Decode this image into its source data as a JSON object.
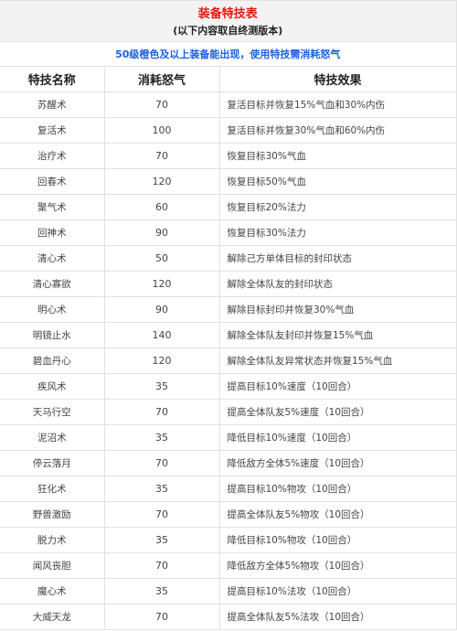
{
  "title": "装备特技表",
  "subtitle": "(以下内容取自终测版本)",
  "note": "50级橙色及以上装备能出现，使用特技需消耗怒气",
  "colors": {
    "title": "#e8160f",
    "note": "#1d5fe0",
    "header_bg": "#f3f3f3",
    "border": "#e2e2e2"
  },
  "columns": [
    "特技名称",
    "消耗怒气",
    "特技效果"
  ],
  "rows": [
    {
      "name": "苏醒术",
      "cost": "70",
      "effect": "复活目标并恢复15%气血和30%内伤"
    },
    {
      "name": "复活术",
      "cost": "100",
      "effect": "复活目标并恢复30%气血和60%内伤"
    },
    {
      "name": "治疗术",
      "cost": "70",
      "effect": "恢复目标30%气血"
    },
    {
      "name": "回春术",
      "cost": "120",
      "effect": "恢复目标50%气血"
    },
    {
      "name": "聚气术",
      "cost": "60",
      "effect": "恢复目标20%法力"
    },
    {
      "name": "回神术",
      "cost": "90",
      "effect": "恢复目标30%法力"
    },
    {
      "name": "清心术",
      "cost": "50",
      "effect": "解除己方单体目标的封印状态"
    },
    {
      "name": "清心寡欲",
      "cost": "120",
      "effect": "解除全体队友的封印状态"
    },
    {
      "name": "明心术",
      "cost": "90",
      "effect": "解除目标封印并恢复30%气血"
    },
    {
      "name": "明镜止水",
      "cost": "140",
      "effect": "解除全体队友封印并恢复15%气血"
    },
    {
      "name": "碧血丹心",
      "cost": "120",
      "effect": "解除全体队友异常状态并恢复15%气血"
    },
    {
      "name": "疾风术",
      "cost": "35",
      "effect": "提高目标10%速度（10回合）"
    },
    {
      "name": "天马行空",
      "cost": "70",
      "effect": "提高全体队友5%速度（10回合）"
    },
    {
      "name": "泥沼术",
      "cost": "35",
      "effect": "降低目标10%速度（10回合）"
    },
    {
      "name": "停云落月",
      "cost": "70",
      "effect": "降低敌方全体5%速度（10回合）"
    },
    {
      "name": "狂化术",
      "cost": "35",
      "effect": "提高目标10%物攻（10回合）"
    },
    {
      "name": "野兽激励",
      "cost": "70",
      "effect": "提高全体队友5%物攻（10回合）"
    },
    {
      "name": "脱力术",
      "cost": "35",
      "effect": "降低目标10%物攻（10回合）"
    },
    {
      "name": "闻风丧胆",
      "cost": "70",
      "effect": "降低敌方全体5%物攻（10回合）"
    },
    {
      "name": "魔心术",
      "cost": "35",
      "effect": "提高目标10%法攻（10回合）"
    },
    {
      "name": "大威天龙",
      "cost": "70",
      "effect": "提高全体队友5%法攻（10回合）"
    }
  ]
}
